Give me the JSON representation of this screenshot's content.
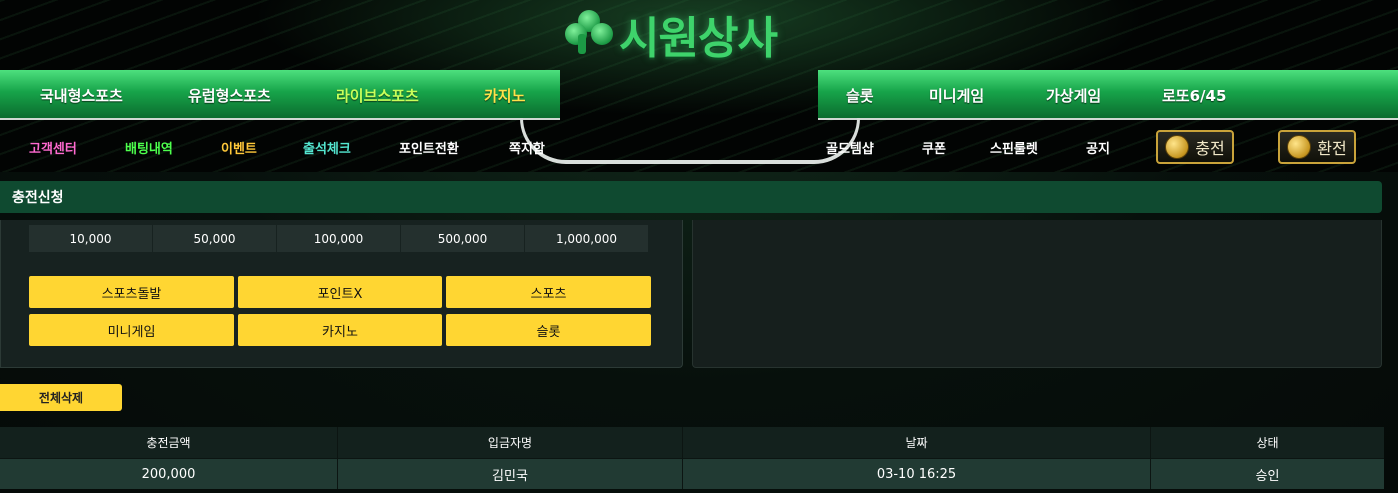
{
  "logo": {
    "text": "시원상사",
    "icon": "clover-icon"
  },
  "main_nav": {
    "left": [
      {
        "label": "국내형스포츠",
        "color": "#ffffff"
      },
      {
        "label": "유럽형스포츠",
        "color": "#ffffff"
      },
      {
        "label": "라이브스포츠",
        "color": "#c8ff5a"
      },
      {
        "label": "카지노",
        "color": "#ffe14a"
      }
    ],
    "right": [
      {
        "label": "슬롯",
        "color": "#ffffff"
      },
      {
        "label": "미니게임",
        "color": "#ffffff"
      },
      {
        "label": "가상게임",
        "color": "#ffffff"
      },
      {
        "label": "로또6/45",
        "color": "#ffffff"
      }
    ]
  },
  "sub_nav": {
    "left": [
      {
        "label": "고객센터",
        "color": "#ff6ad0"
      },
      {
        "label": "배팅내역",
        "color": "#4dff4d"
      },
      {
        "label": "이벤트",
        "color": "#ffc83a"
      },
      {
        "label": "출석체크",
        "color": "#54e6d0"
      },
      {
        "label": "포인트전환",
        "color": "#ffffff"
      },
      {
        "label": "쪽지함",
        "color": "#ffffff"
      }
    ],
    "right": [
      {
        "label": "골드템샵",
        "color": "#ffffff"
      },
      {
        "label": "쿠폰",
        "color": "#ffffff"
      },
      {
        "label": "스핀룰렛",
        "color": "#ffffff"
      },
      {
        "label": "공지",
        "color": "#ffffff"
      }
    ],
    "deposit_label": "충전",
    "withdraw_label": "환전"
  },
  "section": {
    "title": "충전신청"
  },
  "amount_options": [
    "10,000",
    "50,000",
    "100,000",
    "500,000",
    "1,000,000"
  ],
  "game_buttons": [
    "스포츠돌발",
    "포인트X",
    "스포츠",
    "미니게임",
    "카지노",
    "슬롯"
  ],
  "delete_all_label": "전체삭제",
  "history": {
    "columns": [
      "충전금액",
      "입금자명",
      "날짜",
      "상태"
    ],
    "rows": [
      [
        "200,000",
        "김민국",
        "03-10 16:25",
        "승인"
      ]
    ]
  },
  "colors": {
    "accent_green": "#17a44a",
    "button_yellow": "#ffd632",
    "section_green": "#0f4a30"
  }
}
